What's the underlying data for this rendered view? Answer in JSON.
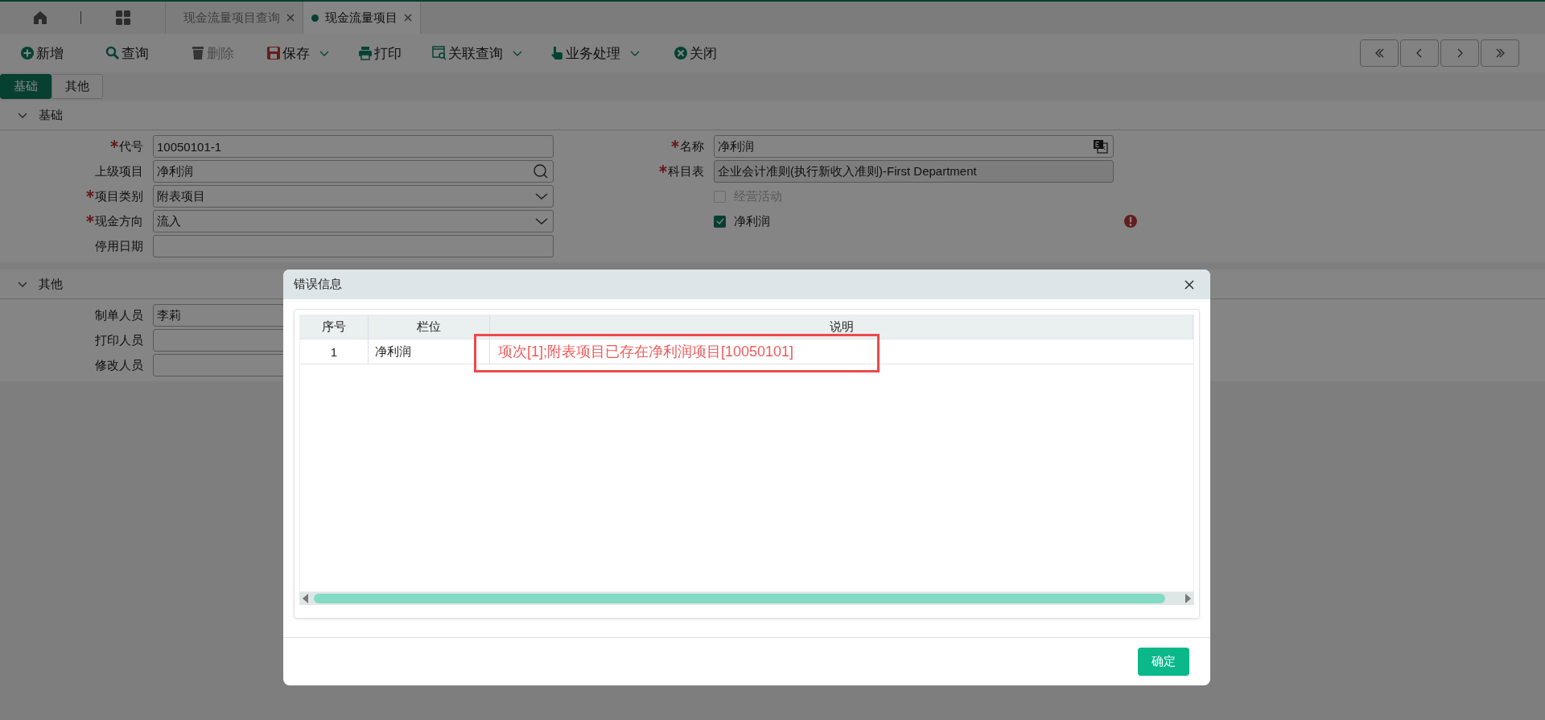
{
  "tab_bar": {
    "tabs": [
      {
        "label": "现金流量项目查询",
        "selected": false
      },
      {
        "label": "现金流量项目",
        "selected": true
      }
    ]
  },
  "toolbar": {
    "buttons": [
      {
        "kind": "add",
        "label": "新增",
        "disabled": false,
        "dropdown": false
      },
      {
        "kind": "search",
        "label": "查询",
        "disabled": false,
        "dropdown": false
      },
      {
        "kind": "delete",
        "label": "删除",
        "disabled": true,
        "dropdown": false
      },
      {
        "kind": "save",
        "label": "保存",
        "disabled": false,
        "dropdown": true
      },
      {
        "kind": "print",
        "label": "打印",
        "disabled": false,
        "dropdown": false
      },
      {
        "kind": "related",
        "label": "关联查询",
        "disabled": false,
        "dropdown": true
      },
      {
        "kind": "process",
        "label": "业务处理",
        "disabled": false,
        "dropdown": true
      },
      {
        "kind": "close",
        "label": "关闭",
        "disabled": false,
        "dropdown": false
      }
    ]
  },
  "form_tabs": [
    {
      "label": "基础",
      "selected": true
    },
    {
      "label": "其他",
      "selected": false
    }
  ],
  "sections": [
    {
      "title": "基础",
      "expanded": true,
      "left_fields": [
        {
          "label": "代号",
          "required": true,
          "kind": "text",
          "value": "10050101-1"
        },
        {
          "label": "上级项目",
          "required": false,
          "kind": "lookup",
          "value": "净利润"
        },
        {
          "label": "项目类别",
          "required": true,
          "kind": "select",
          "value": "附表项目"
        },
        {
          "label": "现金方向",
          "required": true,
          "kind": "select",
          "value": "流入"
        },
        {
          "label": "停用日期",
          "required": false,
          "kind": "text"
        }
      ],
      "right_fields": [
        {
          "label": "名称",
          "required": true,
          "kind": "translate",
          "value": "净利润"
        },
        {
          "label": "科目表",
          "required": true,
          "kind": "readonly",
          "value": "企业会计准则(执行新收入准则)-First Department"
        },
        {
          "kind": "checkbox",
          "label": "经营活动",
          "checked": false,
          "disabled": true,
          "invalid": false
        },
        {
          "kind": "checkbox",
          "label": "净利润",
          "checked": true,
          "disabled": false,
          "invalid": true
        }
      ]
    },
    {
      "title": "其他",
      "expanded": true,
      "left_fields": [
        {
          "label": "制单人员",
          "required": false,
          "kind": "text",
          "value": "李莉"
        },
        {
          "label": "打印人员",
          "required": false,
          "kind": "text"
        },
        {
          "label": "修改人员",
          "required": false,
          "kind": "text"
        }
      ]
    }
  ],
  "dialog": {
    "title": "错误信息",
    "columns": [
      "序号",
      "栏位",
      "说明"
    ],
    "rows": [
      {
        "cells": [
          "1",
          "净利润",
          "项次[1];附表项目已存在净利润项目[10050101]"
        ],
        "highlighted": true
      }
    ],
    "ok_button": "确定"
  }
}
